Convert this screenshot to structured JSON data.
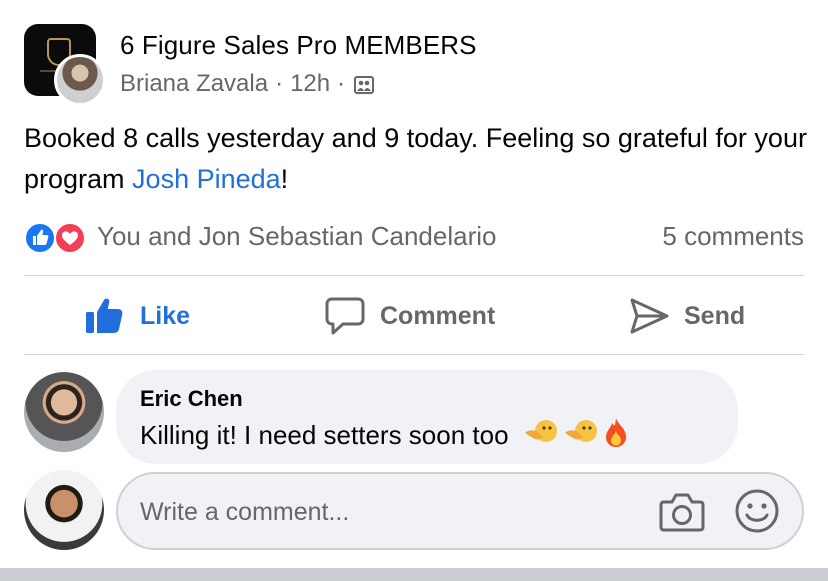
{
  "post": {
    "group_name": "6 Figure Sales Pro MEMBERS",
    "author": "Briana Zavala",
    "time": "12h",
    "separator": "·",
    "privacy_icon": "group-members-icon",
    "text_before_mention": "Booked 8 calls yesterday and 9 today. Feeling so grateful for your program ",
    "mention": "Josh Pineda",
    "text_after_mention": "!"
  },
  "reactions": {
    "icons": [
      "like-reaction-icon",
      "love-reaction-icon"
    ],
    "summary": "You and Jon Sebastian Candelario",
    "comments_count": "5 comments",
    "colors": {
      "like": "#1877f2",
      "love": "#f33e58"
    }
  },
  "actions": {
    "like": "Like",
    "comment": "Comment",
    "send": "Send",
    "active_color": "#216fdb"
  },
  "comment": {
    "author": "Eric Chen",
    "text": "Killing it! I need setters soon too",
    "emojis": [
      "pointing-hand-face-emoji",
      "pointing-hand-face-emoji",
      "fire-emoji"
    ]
  },
  "composer": {
    "placeholder": "Write a comment...",
    "icons": [
      "camera-icon",
      "smiley-icon"
    ]
  }
}
